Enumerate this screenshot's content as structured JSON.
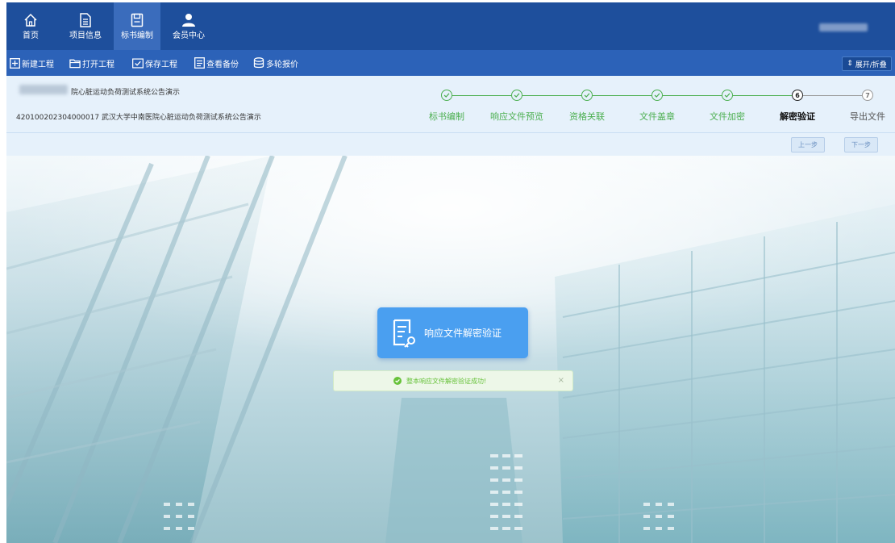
{
  "nav": {
    "items": [
      {
        "label": "首页",
        "icon": "home-icon"
      },
      {
        "label": "项目信息",
        "icon": "document-icon"
      },
      {
        "label": "标书编制",
        "icon": "save-disk-icon",
        "active": true
      },
      {
        "label": "会员中心",
        "icon": "user-icon"
      }
    ]
  },
  "toolbar": {
    "new_project": "新建工程",
    "open_project": "打开工程",
    "save_project": "保存工程",
    "view_backup": "查看备份",
    "multi_round_quote": "多轮报价",
    "expand_collapse": "展开/折叠"
  },
  "project": {
    "name": "院心脏运动负荷测试系统公告演示",
    "code_line": "420100202304000017 武汉大学中南医院心脏运动负荷测试系统公告演示"
  },
  "steps": [
    {
      "label": "标书编制",
      "status": "done"
    },
    {
      "label": "响应文件预览",
      "status": "done"
    },
    {
      "label": "资格关联",
      "status": "done"
    },
    {
      "label": "文件盖章",
      "status": "done"
    },
    {
      "label": "文件加密",
      "status": "done"
    },
    {
      "label": "解密验证",
      "status": "current",
      "number": "6"
    },
    {
      "label": "导出文件",
      "status": "todo",
      "number": "7"
    }
  ],
  "pager": {
    "prev": "上一步",
    "next": "下一步"
  },
  "decrypt": {
    "button_label": "响应文件解密验证"
  },
  "toast": {
    "message": "整本响应文件解密验证成功!",
    "close": "×"
  },
  "colors": {
    "nav_bg": "#1e4f9c",
    "toolbar_bg": "#2c62b8",
    "step_done": "#4caf50",
    "card_bg": "#4a9ff0",
    "toast_text": "#67c23a"
  }
}
